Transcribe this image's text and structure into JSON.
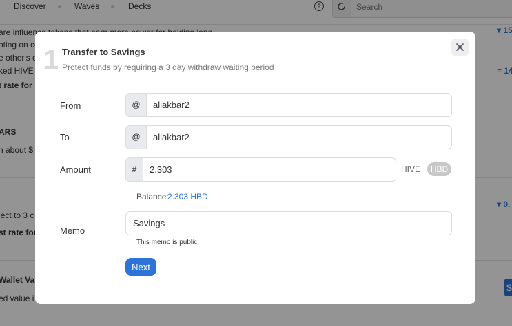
{
  "nav": {
    "items": [
      {
        "label": "Discover"
      },
      {
        "label": "Waves"
      },
      {
        "label": "Decks"
      }
    ],
    "search_placeholder": "Search"
  },
  "background": {
    "lines": [
      {
        "text": "are influence tokens that earn more power for holding long",
        "bold": false
      },
      {
        "text": "oting on co",
        "bold": false
      },
      {
        "text": "e other's c",
        "bold": false
      },
      {
        "text": "ked HIVE",
        "bold": false
      },
      {
        "text": "t rate for",
        "bold": true
      },
      {
        "text": "ARS",
        "bold": true
      },
      {
        "text": "h about $",
        "bold": false
      },
      {
        "text": "ject to 3 c",
        "bold": false
      },
      {
        "text": "st rate for",
        "bold": true
      },
      {
        "text": "Wallet Va",
        "bold": true
      },
      {
        "text": "ed value i",
        "bold": false
      }
    ],
    "right_values": [
      "15",
      "14",
      "0."
    ],
    "usd_symbol": "$"
  },
  "modal": {
    "step_number": "1",
    "title": "Transfer to Savings",
    "subtitle": "Protect funds by requiring a 3 day withdraw waiting period",
    "from": {
      "label": "From",
      "prefix": "@",
      "value": "aliakbar2"
    },
    "to": {
      "label": "To",
      "prefix": "@",
      "value": "aliakbar2"
    },
    "amount": {
      "label": "Amount",
      "prefix": "#",
      "value": "2.303",
      "currency_hive": "HIVE",
      "currency_hbd": "HBD",
      "selected_currency": "HBD"
    },
    "balance": {
      "label": "Balance:",
      "value": "2.303 HBD"
    },
    "memo": {
      "label": "Memo",
      "value": "Savings",
      "hint": "This memo is public"
    },
    "next_label": "Next"
  }
}
